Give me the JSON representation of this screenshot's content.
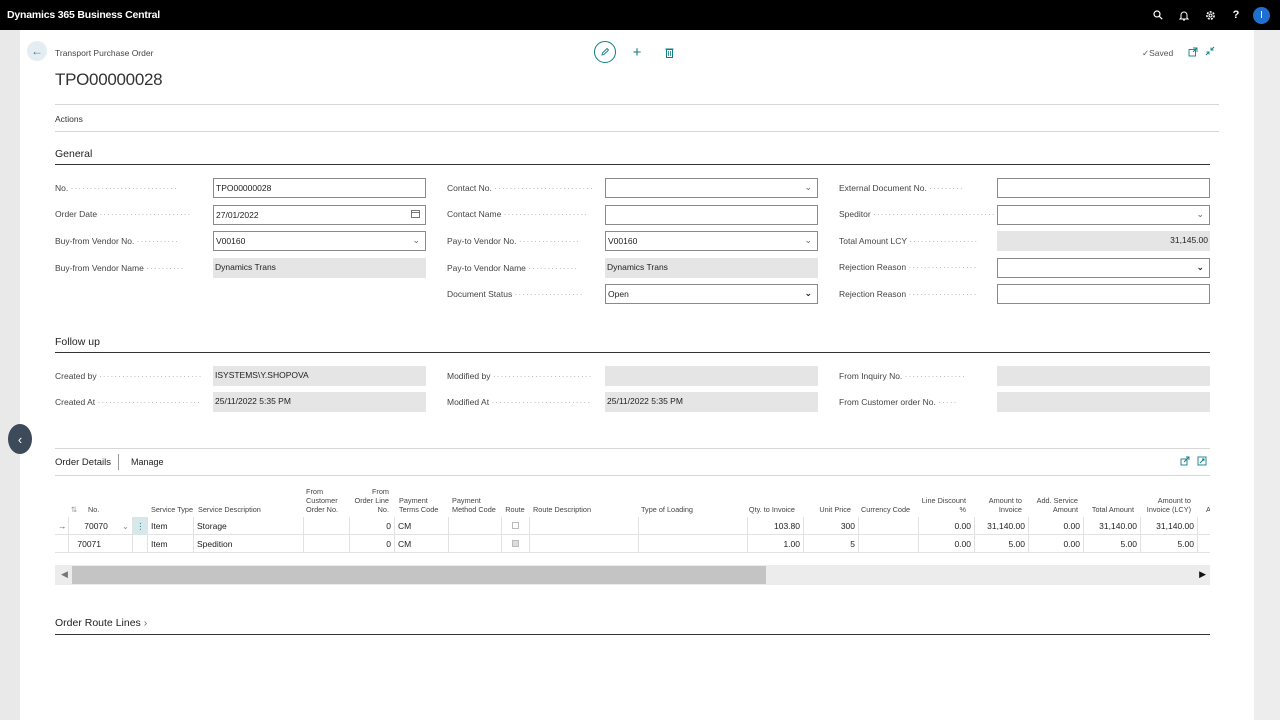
{
  "app": {
    "title": "Dynamics 365 Business Central"
  },
  "topbar": {
    "icons": [
      "search-icon",
      "bell-icon",
      "gear-icon",
      "help-icon"
    ],
    "avatar": "I"
  },
  "page": {
    "caption": "Transport Purchase Order",
    "title": "TPO00000028",
    "saved": "Saved",
    "actions": "Actions"
  },
  "general": {
    "title": "General",
    "col1": [
      {
        "label": "No.",
        "value": "TPO00000028"
      },
      {
        "label": "Order Date",
        "value": "27/01/2022"
      },
      {
        "label": "Buy-from Vendor No.",
        "value": "V00160"
      },
      {
        "label": "Buy-from Vendor Name",
        "value": "Dynamics Trans"
      }
    ],
    "col2": [
      {
        "label": "Contact No.",
        "value": ""
      },
      {
        "label": "Contact Name",
        "value": ""
      },
      {
        "label": "Pay-to Vendor No.",
        "value": "V00160"
      },
      {
        "label": "Pay-to Vendor Name",
        "value": "Dynamics Trans"
      },
      {
        "label": "Document Status",
        "value": "Open"
      }
    ],
    "col3": [
      {
        "label": "External Document No.",
        "value": ""
      },
      {
        "label": "Speditor",
        "value": ""
      },
      {
        "label": "Total Amount LCY",
        "value": "31,145.00"
      },
      {
        "label": "Rejection Reason",
        "value": ""
      },
      {
        "label": "Rejection Reason",
        "value": ""
      }
    ]
  },
  "followup": {
    "title": "Follow up",
    "col1": [
      {
        "label": "Created by",
        "value": "ISYSTEMS\\Y.SHOPOVA"
      },
      {
        "label": "Created At",
        "value": "25/11/2022 5:35 PM"
      }
    ],
    "col2": [
      {
        "label": "Modified by",
        "value": ""
      },
      {
        "label": "Modified At",
        "value": "25/11/2022 5:35 PM"
      }
    ],
    "col3": [
      {
        "label": "From Inquiry No.",
        "value": ""
      },
      {
        "label": "From Customer order No.",
        "value": ""
      }
    ]
  },
  "lines": {
    "tab": "Order Details",
    "manage": "Manage",
    "headers": [
      "No.",
      "Service Type",
      "Service Description",
      "From Customer Order No.",
      "From Order Line No.",
      "Payment Terms Code",
      "Payment Method Code",
      "Route",
      "Route Description",
      "Type of Loading",
      "Qty. to Invoice",
      "Unit Price",
      "Currency Code",
      "Line Discount %",
      "Amount to Invoice",
      "Add. Service Amount",
      "Total Amount",
      "Amount to Invoice (LCY)",
      "A"
    ],
    "rows": [
      {
        "no": "70070",
        "service_type": "Item",
        "service_desc": "Storage",
        "from_cust_order": "",
        "from_line": "0",
        "pay_terms": "CM",
        "pay_method": "",
        "route_desc": "",
        "loading": "",
        "qty": "103.80",
        "unit_price": "300",
        "currency": "",
        "line_disc": "0.00",
        "amt_inv": "31,140.00",
        "add_service": "0.00",
        "total": "31,140.00",
        "amt_lcy": "31,140.00"
      },
      {
        "no": "70071",
        "service_type": "Item",
        "service_desc": "Spedition",
        "from_cust_order": "",
        "from_line": "0",
        "pay_terms": "CM",
        "pay_method": "",
        "route_desc": "",
        "loading": "",
        "qty": "1.00",
        "unit_price": "5",
        "currency": "",
        "line_disc": "0.00",
        "amt_inv": "5.00",
        "add_service": "0.00",
        "total": "5.00",
        "amt_lcy": "5.00"
      }
    ]
  },
  "route_lines": {
    "title": "Order Route Lines"
  },
  "colors": {
    "accent": "#0e7c86",
    "topbar": "#000000",
    "avatar": "#1e6fd0"
  }
}
